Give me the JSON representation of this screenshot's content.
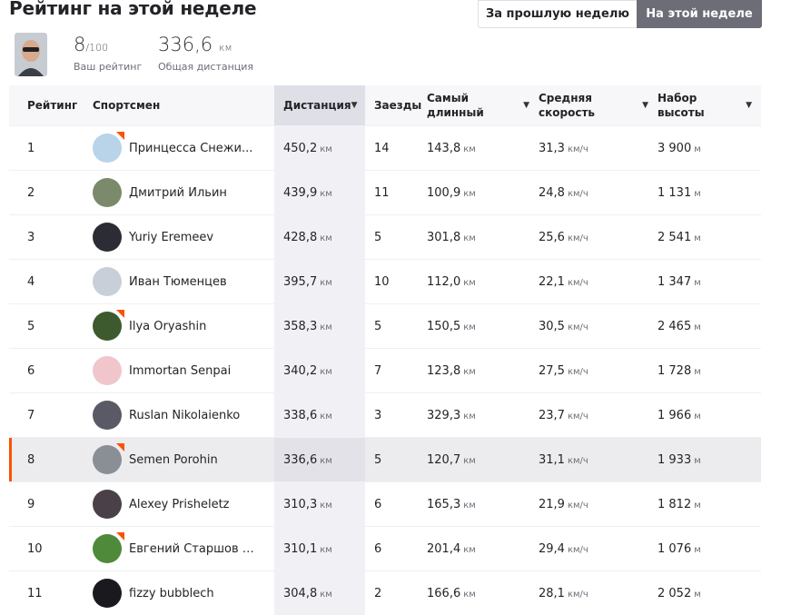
{
  "page": {
    "title": "Рейтинг на этой неделе",
    "tabs": {
      "last_week": "За прошлую неделю",
      "this_week": "На этой неделе"
    }
  },
  "me": {
    "rank": "8",
    "rank_total": "/100",
    "rank_label": "Ваш рейтинг",
    "distance": "336,6",
    "distance_unit": "км",
    "distance_label": "Общая дистанция"
  },
  "table": {
    "headers": {
      "rank": "Рейтинг",
      "athlete": "Спортсмен",
      "distance": "Дистанция",
      "rides": "Заезды",
      "longest": "Самый длинный",
      "speed": "Средняя скорость",
      "elev": "Набор высоты"
    },
    "units": {
      "km": "км",
      "kmh": "км/ч",
      "m": "м"
    },
    "rows": [
      {
        "rank": "1",
        "name": "Принцесса Снежи...",
        "distance": "450,2",
        "rides": "14",
        "longest": "143,8",
        "speed": "31,3",
        "elev": "3 900",
        "avatar_color": "#b9d3e8",
        "badge": true
      },
      {
        "rank": "2",
        "name": "Дмитрий Ильин",
        "distance": "439,9",
        "rides": "11",
        "longest": "100,9",
        "speed": "24,8",
        "elev": "1 131",
        "avatar_color": "#7a8a6a",
        "badge": false
      },
      {
        "rank": "3",
        "name": "Yuriy Eremeev",
        "distance": "428,8",
        "rides": "5",
        "longest": "301,8",
        "speed": "25,6",
        "elev": "2 541",
        "avatar_color": "#2c2c34",
        "badge": false
      },
      {
        "rank": "4",
        "name": "Иван Тюменцев",
        "distance": "395,7",
        "rides": "10",
        "longest": "112,0",
        "speed": "22,1",
        "elev": "1 347",
        "avatar_color": "#c9cfd8",
        "badge": false
      },
      {
        "rank": "5",
        "name": "Ilya Oryashin",
        "distance": "358,3",
        "rides": "5",
        "longest": "150,5",
        "speed": "30,5",
        "elev": "2 465",
        "avatar_color": "#3d5a2e",
        "badge": true
      },
      {
        "rank": "6",
        "name": "Immortan Senpai",
        "distance": "340,2",
        "rides": "7",
        "longest": "123,8",
        "speed": "27,5",
        "elev": "1 728",
        "avatar_color": "#f0c6cc",
        "badge": false
      },
      {
        "rank": "7",
        "name": "Ruslan Nikolaienko",
        "distance": "338,6",
        "rides": "3",
        "longest": "329,3",
        "speed": "23,7",
        "elev": "1 966",
        "avatar_color": "#5a5a66",
        "badge": false
      },
      {
        "rank": "8",
        "name": "Semen Porohin",
        "distance": "336,6",
        "rides": "5",
        "longest": "120,7",
        "speed": "31,1",
        "elev": "1 933",
        "avatar_color": "#8a8f96",
        "badge": true,
        "me": true
      },
      {
        "rank": "9",
        "name": "Alexey Prisheletz",
        "distance": "310,3",
        "rides": "6",
        "longest": "165,3",
        "speed": "21,9",
        "elev": "1 812",
        "avatar_color": "#4a4048",
        "badge": false
      },
      {
        "rank": "10",
        "name": "Евгений Старшов [...",
        "distance": "310,1",
        "rides": "6",
        "longest": "201,4",
        "speed": "29,4",
        "elev": "1 076",
        "avatar_color": "#4e8a3a",
        "badge": true
      },
      {
        "rank": "11",
        "name": "fizzy bubblech",
        "distance": "304,8",
        "rides": "2",
        "longest": "166,6",
        "speed": "28,1",
        "elev": "2 052",
        "avatar_color": "#1a1a1e",
        "badge": false
      }
    ]
  },
  "colors": {
    "accent": "#fc5200",
    "active_tab": "#6d6d78"
  }
}
